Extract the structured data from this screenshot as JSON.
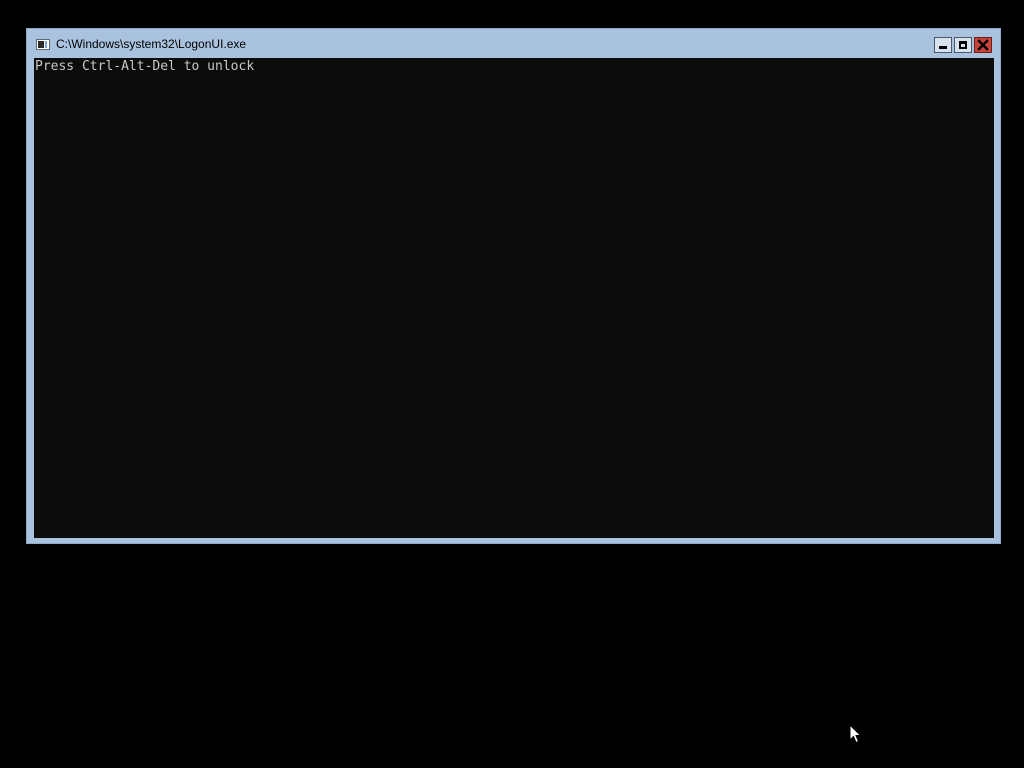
{
  "window": {
    "title": "C:\\Windows\\system32\\LogonUI.exe",
    "icon": "console-window-icon",
    "controls": {
      "minimize": "minimize-icon",
      "maximize": "maximize-icon",
      "close": "close-icon"
    }
  },
  "console": {
    "lines": [
      "Press Ctrl-Alt-Del to unlock"
    ]
  },
  "colors": {
    "desktop_background": "#000000",
    "window_frame": "#a9c3de",
    "console_background": "#0c0c0c",
    "console_text": "#c8c8c8",
    "close_button": "#c7443a"
  },
  "pointer": "mouse-pointer-icon"
}
